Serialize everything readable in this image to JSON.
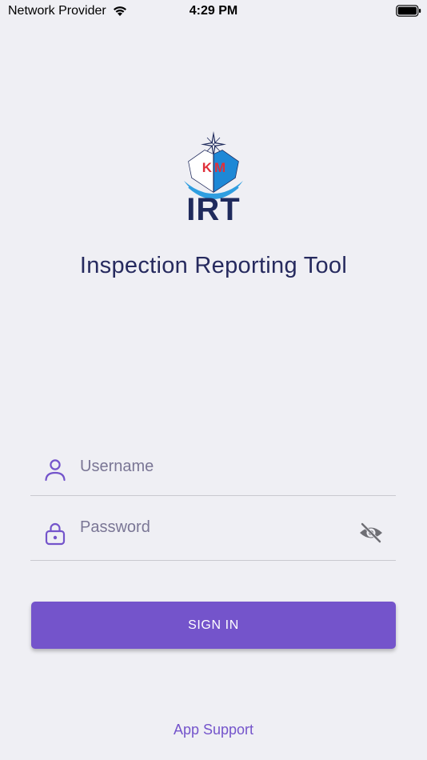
{
  "status_bar": {
    "carrier": "Network Provider",
    "time": "4:29 PM",
    "wifi_icon": "wifi-icon",
    "battery_icon": "battery-full-icon"
  },
  "logo": {
    "emblem_letters": "KM",
    "wordmark": "IRT",
    "icon": "km-irt-logo"
  },
  "app": {
    "title": "Inspection Reporting Tool"
  },
  "login_form": {
    "username": {
      "placeholder": "Username",
      "value": "",
      "icon": "user-icon"
    },
    "password": {
      "placeholder": "Password",
      "value": "",
      "icon": "lock-icon",
      "toggle_icon": "eye-off-icon"
    },
    "signin_label": "SIGN IN"
  },
  "footer": {
    "support_label": "App Support"
  },
  "colors": {
    "background": "#efeff4",
    "accent": "#7454cb",
    "title": "#262a5e",
    "logo_navy": "#1f2a5c",
    "logo_red": "#e0303a",
    "logo_blue": "#1e88d6"
  }
}
